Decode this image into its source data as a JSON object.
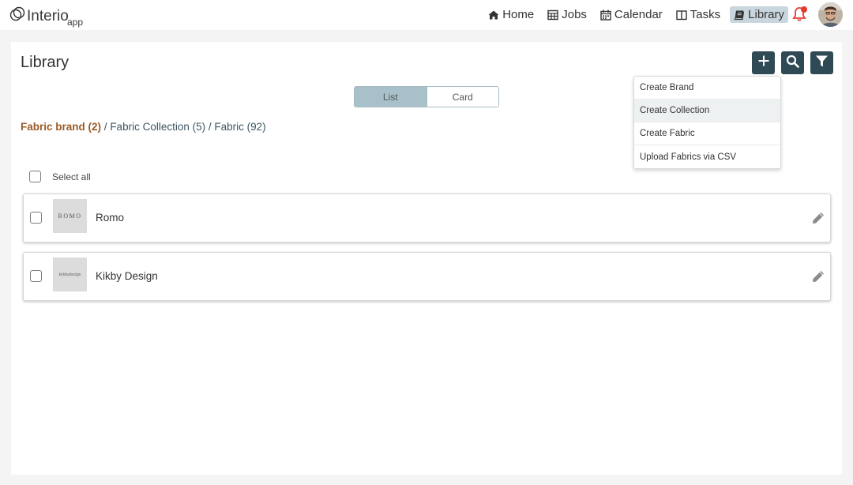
{
  "brand": {
    "name": "Interio",
    "suffix": "app"
  },
  "nav": {
    "items": [
      {
        "label": "Home",
        "icon": "home-icon"
      },
      {
        "label": "Jobs",
        "icon": "table-icon"
      },
      {
        "label": "Calendar",
        "icon": "calendar-icon"
      },
      {
        "label": "Tasks",
        "icon": "columns-icon"
      },
      {
        "label": "Library",
        "icon": "book-icon",
        "active": true
      }
    ]
  },
  "page": {
    "title": "Library",
    "view_toggle": {
      "list": "List",
      "card": "Card",
      "selected": "List"
    },
    "breadcrumb": {
      "brand": "Fabric brand (2)",
      "sep": "/",
      "collection": "Fabric Collection (5)",
      "fabric": "Fabric (92)"
    },
    "select_all": "Select all",
    "rows": [
      {
        "name": "Romo",
        "logo_text": "ROMO"
      },
      {
        "name": "Kikby Design",
        "logo_text": "kirkbydesign"
      }
    ]
  },
  "add_menu": {
    "items": [
      {
        "label": "Create Brand"
      },
      {
        "label": "Create Collection",
        "highlighted": true
      },
      {
        "label": "Create Fabric"
      },
      {
        "label": "Upload Fabrics via CSV"
      }
    ]
  },
  "colors": {
    "accent_dark": "#2f4a55",
    "breadcrumb_active": "#9a5a26",
    "toggle_selected": "#a8c0ca",
    "bell": "#e23b2e"
  }
}
